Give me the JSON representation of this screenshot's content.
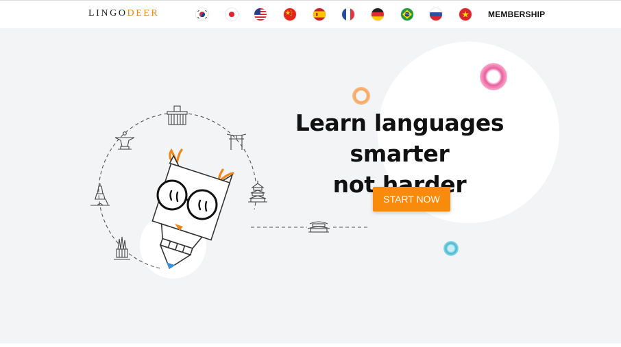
{
  "header": {
    "logo_part1": "LINGO",
    "logo_part2": "DEER",
    "flags": [
      {
        "name": "korean-flag-icon"
      },
      {
        "name": "japanese-flag-icon"
      },
      {
        "name": "english-us-flag-icon"
      },
      {
        "name": "chinese-flag-icon"
      },
      {
        "name": "spanish-flag-icon"
      },
      {
        "name": "french-flag-icon"
      },
      {
        "name": "german-flag-icon"
      },
      {
        "name": "portuguese-brazil-flag-icon"
      },
      {
        "name": "russian-flag-icon"
      },
      {
        "name": "vietnamese-flag-icon"
      }
    ],
    "membership_label": "MEMBERSHIP"
  },
  "hero": {
    "headline_line1": "Learn languages smarter",
    "headline_line2": "not harder",
    "cta_label": "START NOW"
  },
  "colors": {
    "accent_orange": "#f98b0c",
    "logo_orange": "#f08519",
    "hero_background": "#f3f4f6"
  },
  "icons": [
    "owl-mascot-icon",
    "brandenburg-gate-icon",
    "torii-gate-icon",
    "temple-of-heaven-icon",
    "korean-palace-icon",
    "christ-redeemer-icon",
    "eiffel-tower-icon",
    "sagrada-familia-icon"
  ]
}
